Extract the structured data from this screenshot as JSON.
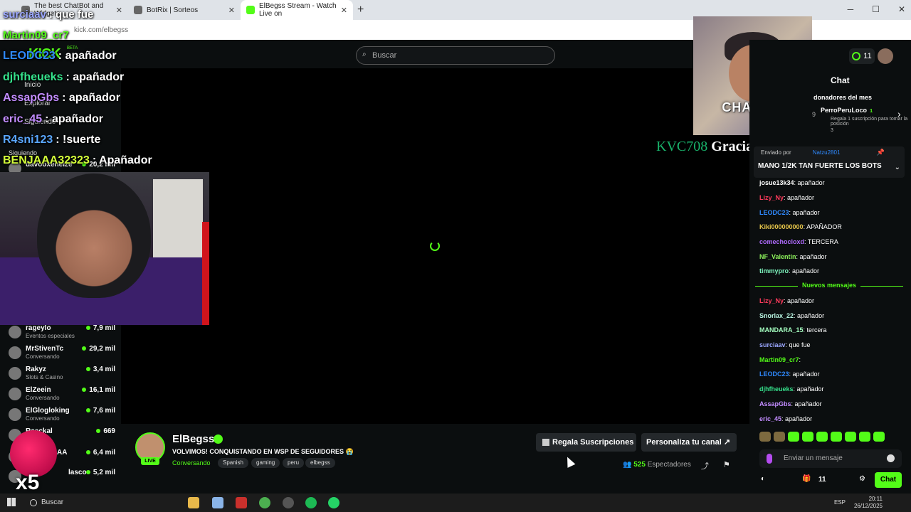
{
  "browser": {
    "tabs": [
      {
        "title": "The best ChatBot and Widgets"
      },
      {
        "title": "BotRix | Sorteos"
      },
      {
        "title": "ElBegss Stream - Watch Live on"
      }
    ],
    "url": "kick.com/elbegss"
  },
  "page": {
    "search_placeholder": "Buscar",
    "sidebar": {
      "nav": [
        "Inicio",
        "Explorar",
        "Siguiendo"
      ],
      "section_following": "Siguiendo",
      "streamers": [
        {
          "name": "davooxeneize",
          "category": "",
          "viewers": "20,2 mil"
        },
        {
          "name": "rageylo",
          "category": "Eventos especiales",
          "viewers": "7,9 mil"
        },
        {
          "name": "MrStivenTc",
          "category": "Conversando",
          "viewers": "29,2 mil"
        },
        {
          "name": "Rakyz",
          "category": "Slots & Casino",
          "viewers": "3,4 mil"
        },
        {
          "name": "ElZeein",
          "category": "Conversando",
          "viewers": "16,1 mil"
        },
        {
          "name": "ElGlogloking",
          "category": "Conversando",
          "viewers": "7,6 mil"
        },
        {
          "name": "Reeckal",
          "category": "",
          "viewers": "669"
        },
        {
          "name": "AA",
          "category": "",
          "viewers": "6,4 mil"
        },
        {
          "name": "lasco",
          "category": "",
          "viewers": "5,2 mil"
        }
      ]
    },
    "overlay_chat": [
      {
        "user": "surciaav",
        "msg": ": que fue",
        "color": "#9ba7ff"
      },
      {
        "user": "Martin09_cr7",
        "msg": "",
        "color": "#53fc18"
      },
      {
        "user": "LEODC23",
        "msg": ": apañador",
        "color": "#2f8aff"
      },
      {
        "user": "djhfheueks",
        "msg": ": apañador",
        "color": "#35e28c"
      },
      {
        "user": "AssapGbs",
        "msg": ": apañador",
        "color": "#c28cff"
      },
      {
        "user": "eric_45",
        "msg": ": apañador",
        "color": "#c28cff"
      },
      {
        "user": "R4sni123",
        "msg": ": !suerte",
        "color": "#5aa7ff"
      },
      {
        "user": "BENJAAA32323",
        "msg": ": Apañador",
        "color": "#d4ff3a"
      }
    ],
    "logo_text": "KICK",
    "logo_beta": "BETA",
    "follow_alert": {
      "user": "KVC708",
      "text": "Gracias por seguirme!!"
    },
    "kid_cam_caption": "CHAVITO",
    "x5": "x5",
    "channel": {
      "name": "ElBegss",
      "live": "LIVE",
      "title": "VOLVIMOS! CONQUISTANDO EN WSP DE SEGUIDORES 😭",
      "category": "Conversando",
      "tags": [
        "Spanish",
        "gaming",
        "peru",
        "elbegss"
      ],
      "gift_button": "Regala Suscripciones",
      "customize_button": "Personaliza tu canal",
      "viewers_count": "525",
      "viewers_label": "Espectadores"
    }
  },
  "chat": {
    "title": "Chat",
    "online_count": "11",
    "donors_title": "donadores del mes",
    "donor_rank": "9",
    "donor_name": "PerroPeruLoco",
    "donor_count": "1",
    "donor_sub": "Regala 1 suscripción para tomar la posición",
    "donor_pos": "3",
    "pinned": {
      "label": "Enviado por",
      "user": "Natzu2801",
      "text": "MANO 1/2K TAN FUERTE LOS BOTS"
    },
    "messages_before": [
      {
        "user": "josue13k34",
        "msg": ": apañador",
        "color": "#ffffff"
      },
      {
        "user": "Lizy_Ny",
        "msg": ": apañador",
        "color": "#ff3b5c"
      },
      {
        "user": "LEODC23",
        "msg": ": apañador",
        "color": "#2f8aff"
      },
      {
        "user": "Kiki000000000",
        "msg": ": APAÑADOR",
        "color": "#e6c54a"
      },
      {
        "user": "comechocloxd",
        "msg": ": TERCERA",
        "color": "#b06bff"
      },
      {
        "user": "NF_Valentin",
        "msg": ": apañador",
        "color": "#8df25c"
      },
      {
        "user": "timmypro",
        "msg": ": apañador",
        "color": "#7ff7c0"
      }
    ],
    "new_messages_label": "Nuevos mensajes",
    "messages_after": [
      {
        "user": "Lizy_Ny",
        "msg": ": apañador",
        "color": "#ff3b5c"
      },
      {
        "user": "Snorlax_22",
        "msg": ": apañador",
        "color": "#b9f5e2"
      },
      {
        "user": "MANDARA_15",
        "msg": ": tercera",
        "color": "#a4ffc0"
      },
      {
        "user": "surciaav",
        "msg": ": que fue",
        "color": "#9ba7ff"
      },
      {
        "user": "Martin09_cr7",
        "msg": ":",
        "color": "#53fc18"
      },
      {
        "user": "LEODC23",
        "msg": ": apañador",
        "color": "#2f8aff"
      },
      {
        "user": "djhfheueks",
        "msg": ": apañador",
        "color": "#35e28c"
      },
      {
        "user": "AssapGbs",
        "msg": ": apañador",
        "color": "#c28cff"
      },
      {
        "user": "eric_45",
        "msg": ": apañador",
        "color": "#c28cff"
      }
    ],
    "input_placeholder": "Enviar un mensaje",
    "points": "11",
    "send_button": "Chat"
  },
  "taskbar": {
    "search": "Buscar",
    "lang": "ESP",
    "time": "20:11",
    "date": "26/12/2025"
  }
}
